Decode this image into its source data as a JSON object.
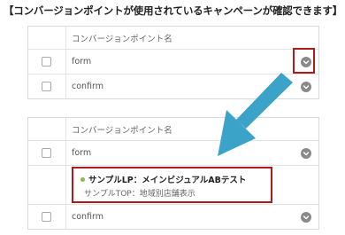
{
  "caption": "【コンバージョンポイントが使用されているキャンペーンが確認できます】",
  "table_top": {
    "header": "コンバージョンポイント名",
    "rows": [
      {
        "name": "form"
      },
      {
        "name": "confirm"
      }
    ]
  },
  "table_bottom": {
    "header": "コンバージョンポイント名",
    "rows": [
      {
        "name": "form"
      },
      {
        "name": "confirm"
      }
    ],
    "detail": {
      "campaign": "サンプルLP：メインビジュアルABテスト",
      "page": "サンプルTOP：地域別店舗表示"
    }
  },
  "colors": {
    "highlight": "#b01a1a",
    "arrow": "#3ba3c7",
    "bullet": "#8bb84a"
  },
  "icons": {
    "expand": "chevron-down-icon"
  }
}
